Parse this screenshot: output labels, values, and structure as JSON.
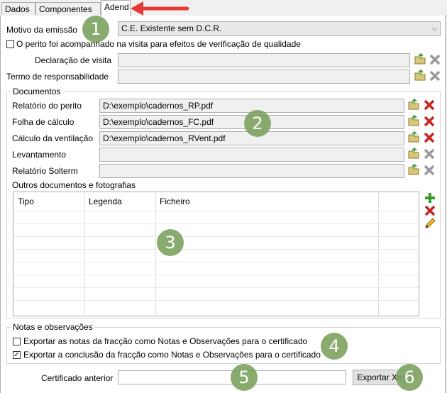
{
  "tabs": [
    {
      "label": "Dados"
    },
    {
      "label": "Componentes"
    },
    {
      "label": "Adend"
    }
  ],
  "emissao": {
    "label": "Motivo da emissão",
    "value": "C.E. Existente sem D.C.R."
  },
  "acompanhado": {
    "label": "O perito foi acompanhado na visita para efeitos de verificação de qualidade",
    "checked": false
  },
  "declaracao_visita": {
    "label": "Declaração de visita",
    "value": ""
  },
  "termo_responsabilidade": {
    "label": "Termo de responsabilidade",
    "value": ""
  },
  "documentos": {
    "title": "Documentos",
    "rows": [
      {
        "label": "Relatório do perito",
        "value": "D:\\exemplo\\cadernos_RP.pdf",
        "delete_active": true
      },
      {
        "label": "Folha de cálculo",
        "value": "D:\\exemplo\\cadernos_FC.pdf",
        "delete_active": true
      },
      {
        "label": "Cálculo da ventilação",
        "value": "D:\\exemplo\\cadernos_RVent.pdf",
        "delete_active": true
      },
      {
        "label": "Levantamento",
        "value": "",
        "delete_active": false
      },
      {
        "label": "Relatório Solterm",
        "value": "",
        "delete_active": false
      }
    ],
    "outros_label": "Outros documentos e fotografias",
    "columns": [
      "Tipo",
      "Legenda",
      "Ficheiro"
    ]
  },
  "notas": {
    "title": "Notas e observações",
    "options": [
      {
        "label": "Exportar as notas da fracção como Notas e Observações para o certificado",
        "checked": false
      },
      {
        "label": "Exportar a conclusão da fracção como Notas e Observações para o certificado",
        "checked": true
      }
    ]
  },
  "certificado_anterior": {
    "label": "Certificado anterior",
    "value": ""
  },
  "export_button": {
    "label": "Exportar Xml"
  },
  "annotations": [
    "1",
    "2",
    "3",
    "4",
    "5",
    "6"
  ],
  "colors": {
    "add": "#3a9a2a",
    "delete_active": "#cc2222",
    "delete_inactive": "#9a9a9a",
    "folder": "#9a8a3a",
    "badge": "#7ea361",
    "arrow": "#e53935"
  },
  "icons": [
    "open-folder-icon",
    "delete-icon",
    "add-icon",
    "edit-pencil-icon",
    "chevron-down-icon"
  ]
}
